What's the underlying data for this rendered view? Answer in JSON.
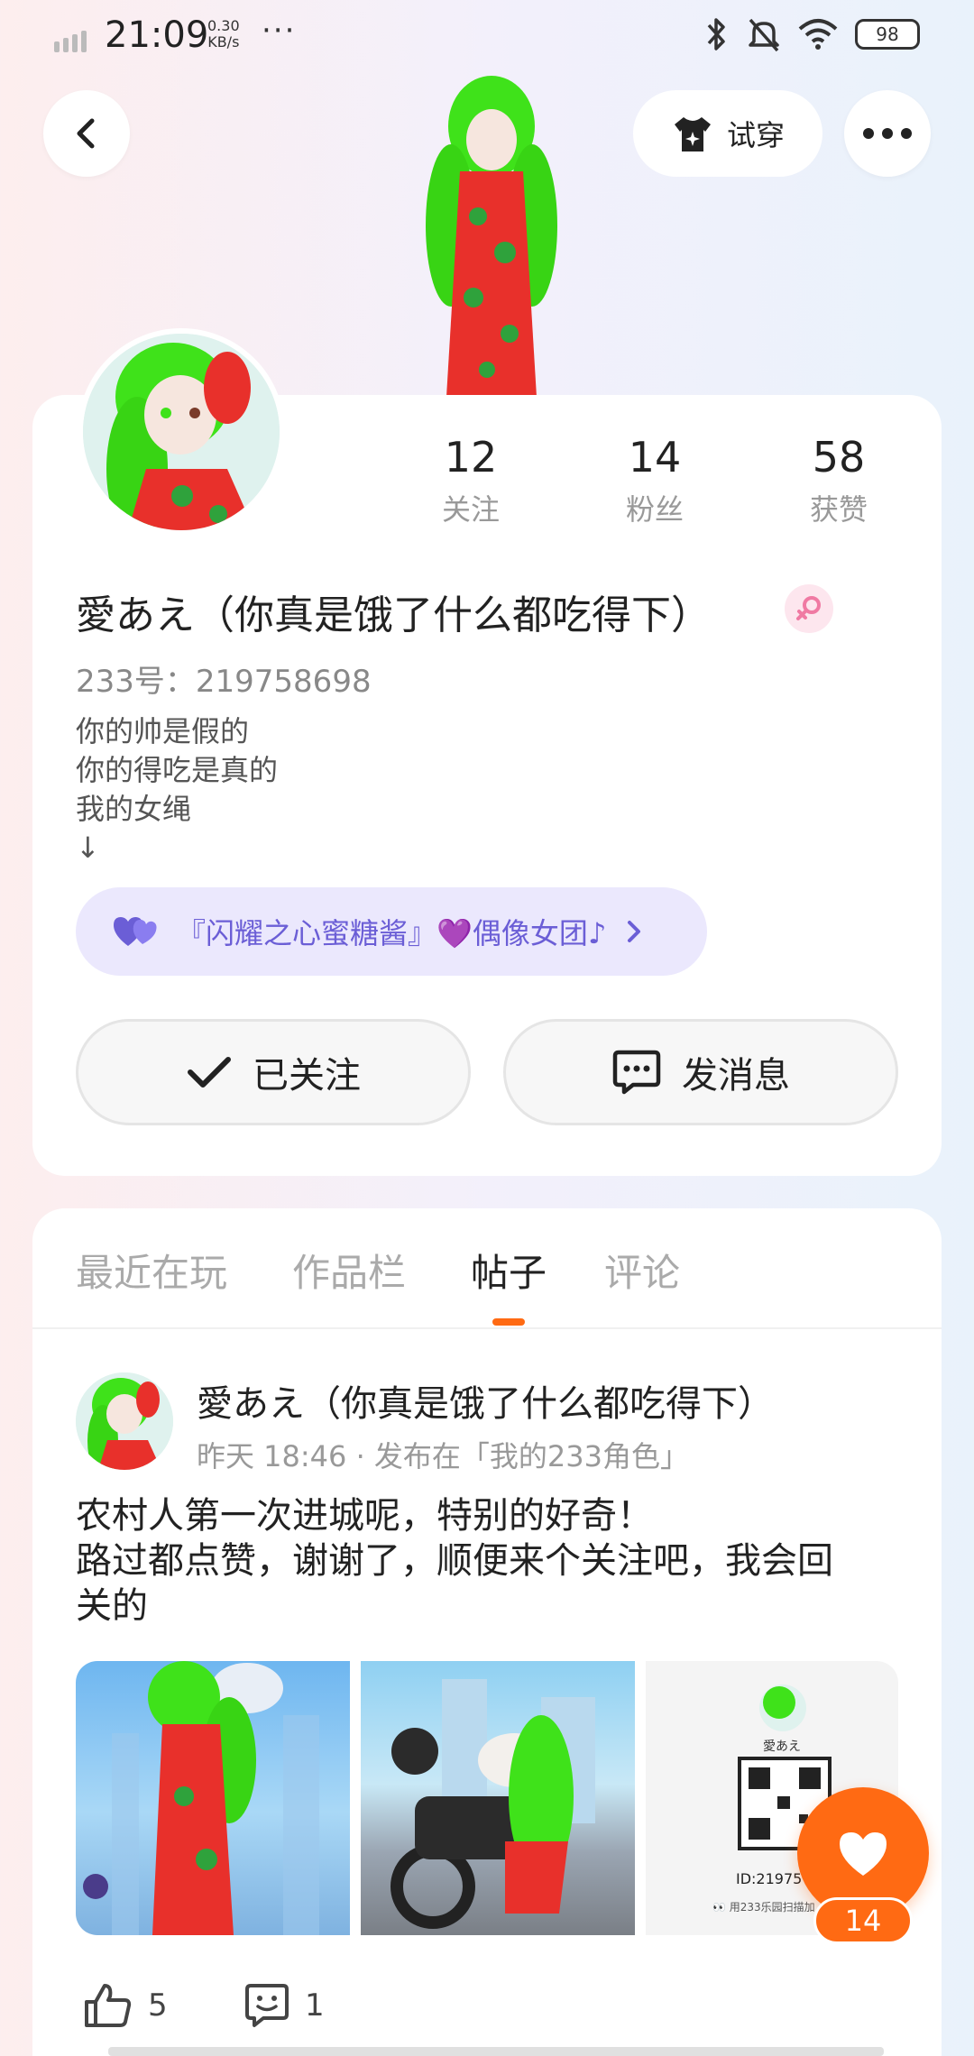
{
  "status_bar": {
    "time": "21:09",
    "net_speed_value": "0.30",
    "net_speed_unit": "KB/s",
    "more_dots": "···",
    "battery": "98",
    "icons": [
      "signal-icon",
      "bluetooth-icon",
      "mute-icon",
      "wifi-icon",
      "battery-icon"
    ]
  },
  "header": {
    "back_icon": "chevron-left-icon",
    "tryon_label": "试穿",
    "tryon_icon": "tshirt-icon",
    "more_icon": "more-dots-icon"
  },
  "profile": {
    "stats": [
      {
        "value": "12",
        "label": "关注"
      },
      {
        "value": "14",
        "label": "粉丝"
      },
      {
        "value": "58",
        "label": "获赞"
      }
    ],
    "nickname": "愛あえ（你真是饿了什么都吃得下）",
    "gender": "female",
    "uid": "233号：219758698",
    "bio": [
      "你的帅是假的",
      "你的得吃是真的",
      "我的女绳",
      "↓"
    ],
    "group": "『闪耀之心蜜糖酱』💜偶像女团♪",
    "follow_label": "已关注",
    "message_label": "发消息"
  },
  "tabs": [
    {
      "label": "最近在玩",
      "active": false
    },
    {
      "label": "作品栏",
      "active": false
    },
    {
      "label": "帖子",
      "active": true
    },
    {
      "label": "评论",
      "active": false
    }
  ],
  "post": {
    "author": "愛あえ（你真是饿了什么都吃得下）",
    "meta": "昨天 18:46 · 发布在「我的233角色」",
    "text_lines": [
      "农村人第一次进城呢，特别的好奇！",
      "路过都点赞，谢谢了，顺便来个关注吧，我会回",
      "关的"
    ],
    "img3_caption": "愛あえ",
    "img3_id": "ID:21975",
    "img3_footer": "👀 用233乐园扫描加",
    "likes": "5",
    "comments": "1",
    "fab_likes": "14"
  },
  "colors": {
    "accent": "#ff6a13",
    "group_bg": "#ebe8fd",
    "group_text": "#6b5ed6",
    "gender_badge_bg": "#fde6ee",
    "hair_green": "#3fe21a",
    "dress_red": "#e8302b"
  }
}
